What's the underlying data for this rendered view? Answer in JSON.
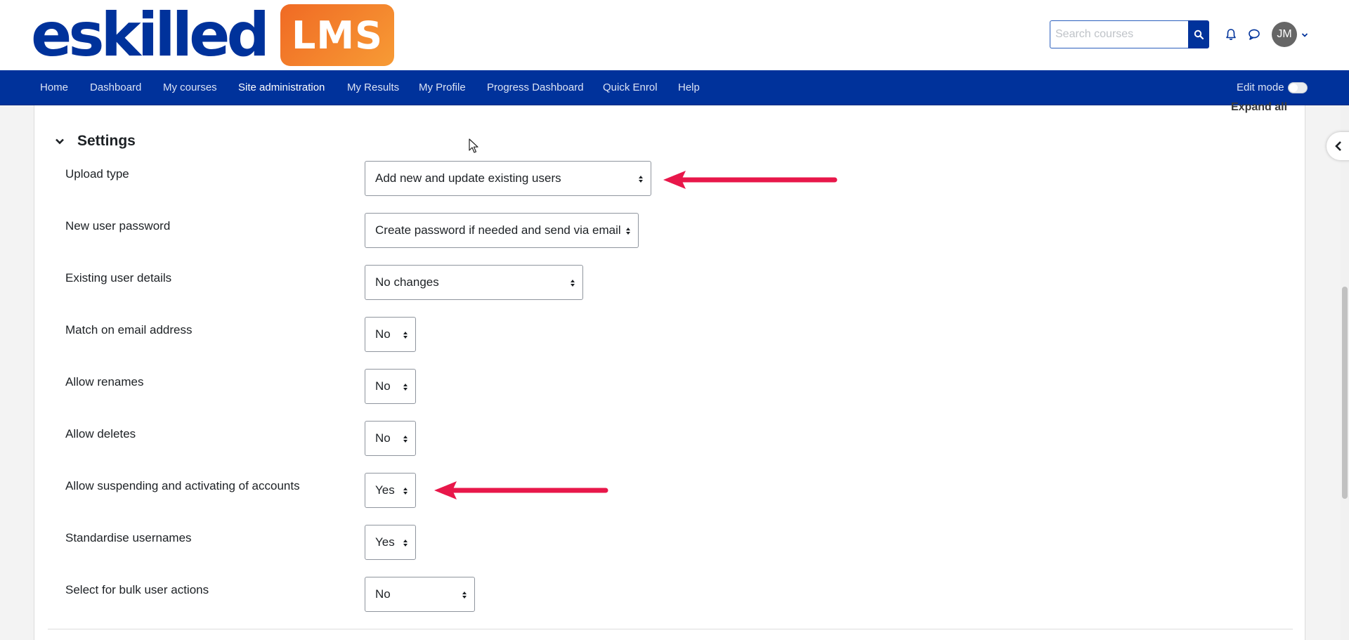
{
  "brand": {
    "wordmark": "eskilled",
    "badge": "LMS",
    "wordmark_color": "#00329b",
    "badge_color": "#f58230"
  },
  "header": {
    "search_placeholder": "Search courses",
    "search_icon": "search-icon",
    "notifications_icon": "bell-icon",
    "messages_icon": "chat-bubble-icon",
    "user_initials": "JM"
  },
  "nav": {
    "items": [
      "Home",
      "Dashboard",
      "My courses",
      "Site administration",
      "My Results",
      "My Profile",
      "Progress Dashboard",
      "Quick Enrol",
      "Help"
    ],
    "active": "Site administration",
    "edit_mode_label": "Edit mode",
    "edit_mode_on": false,
    "bg_color": "#00329b"
  },
  "page": {
    "expand_all": "Expand all"
  },
  "settings": {
    "title": "Settings",
    "rows": [
      {
        "label": "Upload type",
        "value": "Add new and update existing users"
      },
      {
        "label": "New user password",
        "value": "Create password if needed and send via email"
      },
      {
        "label": "Existing user details",
        "value": "No changes"
      },
      {
        "label": "Match on email address",
        "value": "No"
      },
      {
        "label": "Allow renames",
        "value": "No"
      },
      {
        "label": "Allow deletes",
        "value": "No"
      },
      {
        "label": "Allow suspending and activating of accounts",
        "value": "Yes"
      },
      {
        "label": "Standardise usernames",
        "value": "Yes"
      },
      {
        "label": "Select for bulk user actions",
        "value": "No"
      }
    ]
  },
  "annotations": {
    "arrow_color": "#e8174a"
  }
}
